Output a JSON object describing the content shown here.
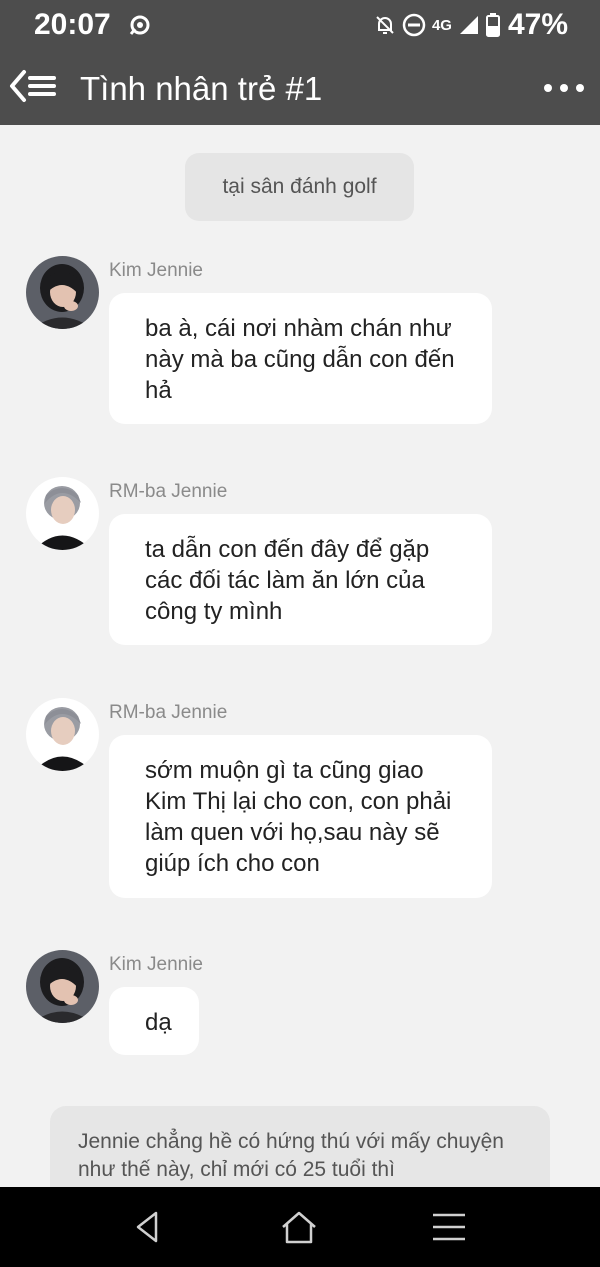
{
  "status_bar": {
    "time": "20:07",
    "network": "4G",
    "battery": "47%",
    "icons": [
      "notification-icon",
      "mute-icon",
      "dnd-icon",
      "signal-icon",
      "battery-icon"
    ]
  },
  "header": {
    "title": "Tình nhân trẻ #1",
    "icons": [
      "back-list-icon",
      "more-icon"
    ]
  },
  "scene": {
    "label": "tại sân đánh golf"
  },
  "messages": [
    {
      "sender": "Kim Jennie",
      "text": "ba à, cái nơi nhàm chán như này mà ba cũng dẫn con đến hả"
    },
    {
      "sender": "RM-ba Jennie",
      "text": "ta dẫn con đến đây để gặp các đối tác làm ăn lớn của công ty mình"
    },
    {
      "sender": "RM-ba Jennie",
      "text": "sớm muộn gì ta cũng giao Kim Thị lại cho con, con phải làm quen với họ,sau này sẽ giúp ích cho con"
    },
    {
      "sender": "Kim Jennie",
      "text": "dạ"
    }
  ],
  "narration": {
    "text": "Jennie chẳng hề có hứng thú với mấy chuyện như thế này, chỉ mới có 25 tuổi thì"
  },
  "nav": {
    "icons": [
      "back-triangle-icon",
      "home-icon",
      "menu-icon"
    ]
  },
  "colors": {
    "app_bar": "#4d4d4d",
    "background": "#f2f2f2",
    "bubble": "#ffffff",
    "nav_bar": "#000000"
  }
}
